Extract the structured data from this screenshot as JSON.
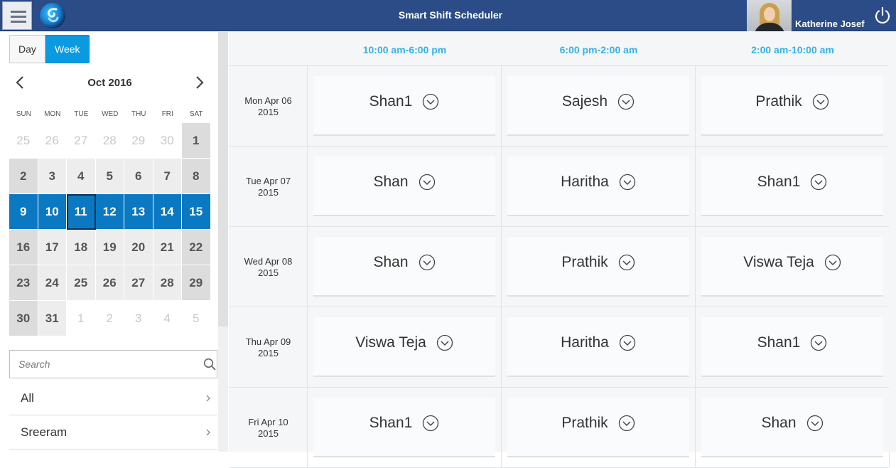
{
  "header": {
    "title": "Smart Shift Scheduler",
    "user_name": "Katherine Josef",
    "colors": {
      "bar": "#2b4c86",
      "accent": "#0b9ae0"
    }
  },
  "sidebar": {
    "view_toggle": {
      "day_label": "Day",
      "week_label": "Week",
      "selected": "Week"
    },
    "calendar": {
      "month_label": "Oct 2016",
      "weekday_labels": [
        "SUN",
        "MON",
        "TUE",
        "WED",
        "THU",
        "FRI",
        "SAT"
      ],
      "weeks": [
        [
          "25",
          "26",
          "27",
          "28",
          "29",
          "30",
          "1"
        ],
        [
          "2",
          "3",
          "4",
          "5",
          "6",
          "7",
          "8"
        ],
        [
          "9",
          "10",
          "11",
          "12",
          "13",
          "14",
          "15"
        ],
        [
          "16",
          "17",
          "18",
          "19",
          "20",
          "21",
          "22"
        ],
        [
          "23",
          "24",
          "25",
          "26",
          "27",
          "28",
          "29"
        ],
        [
          "30",
          "31",
          "1",
          "2",
          "3",
          "4",
          "5"
        ]
      ],
      "selected_week_index": 2,
      "today": "11"
    },
    "search": {
      "placeholder": "Search",
      "value": ""
    },
    "filters": [
      {
        "label": "All"
      },
      {
        "label": "Sreeram"
      }
    ]
  },
  "schedule": {
    "shift_headers": [
      "10:00 am-6:00 pm",
      "6:00 pm-2:00 am",
      "2:00 am-10:00 am"
    ],
    "rows": [
      {
        "date_line1": "Mon Apr 06",
        "date_line2": "2015",
        "assignments": [
          "Shan1",
          "Sajesh",
          "Prathik"
        ]
      },
      {
        "date_line1": "Tue Apr 07",
        "date_line2": "2015",
        "assignments": [
          "Shan",
          "Haritha",
          "Shan1"
        ]
      },
      {
        "date_line1": "Wed Apr 08",
        "date_line2": "2015",
        "assignments": [
          "Shan",
          "Prathik",
          "Viswa Teja"
        ]
      },
      {
        "date_line1": "Thu Apr 09",
        "date_line2": "2015",
        "assignments": [
          "Viswa Teja",
          "Haritha",
          "Shan1"
        ]
      },
      {
        "date_line1": "Fri Apr 10",
        "date_line2": "2015",
        "assignments": [
          "Shan1",
          "Prathik",
          "Shan"
        ]
      }
    ]
  }
}
